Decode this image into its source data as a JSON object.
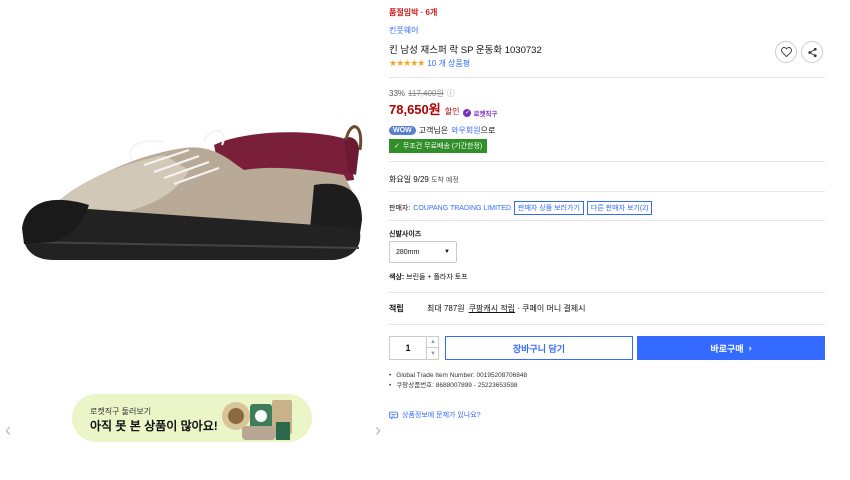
{
  "gallery": {
    "prev_icon": "chevron-left-icon",
    "next_icon": "chevron-right-icon"
  },
  "banner": {
    "subtitle": "로켓직구 둘러보기",
    "title": "아직 못 본 상품이 많아요!"
  },
  "product": {
    "urgency": "품절임박 · 6개",
    "brand": "킨풋웨어",
    "title": "킨 남성 재스퍼 락 SP 운동화 1030732",
    "stars": "★★★★★",
    "review_text": "10 개 상품평",
    "discount_rate": "33%",
    "original_price": "117,400원",
    "info_icon": "ⓘ",
    "price": "78,650원",
    "price_tag": "할인",
    "rocket_label": "로켓직구",
    "wow_badge": "WOW",
    "wow_text_pre": "고객님은",
    "wow_link": "와우회원",
    "wow_text_post": "으로",
    "free_shipping": "무조건 무료배송 (기간한정)",
    "arrival_day": "화요일 9/29",
    "arrival_suffix": "도착 예정",
    "seller_label": "판매자:",
    "seller_name": "COUPANG TRADING LIMITED",
    "seller_link": "판매자 상품 보러가기",
    "other_sellers": "다른 판매자 보기(2)",
    "size_label": "신발사이즈",
    "size_value": "280mm",
    "color_label": "색상:",
    "color_value": "브린들 + 폴라자 토프",
    "points_label": "적립",
    "points_text": "최대 787원",
    "points_link": "쿠팡캐시 적립",
    "points_suffix": "· 쿠페이 머니 결제시",
    "quantity": "1",
    "cart_button": "장바구니 담기",
    "buy_button": "바로구매",
    "gtin": "Global Trade Item Number: 00195208706848",
    "product_code": "쿠팡상품번호: 8688007899 - 25223653598",
    "qa_link": "상품정보에 문제가 있나요?"
  },
  "colors": {
    "accent_blue": "#346aff",
    "price_red": "#ae0000",
    "shipping_green": "#318f2a",
    "banner_green": "#eaf6c7"
  }
}
